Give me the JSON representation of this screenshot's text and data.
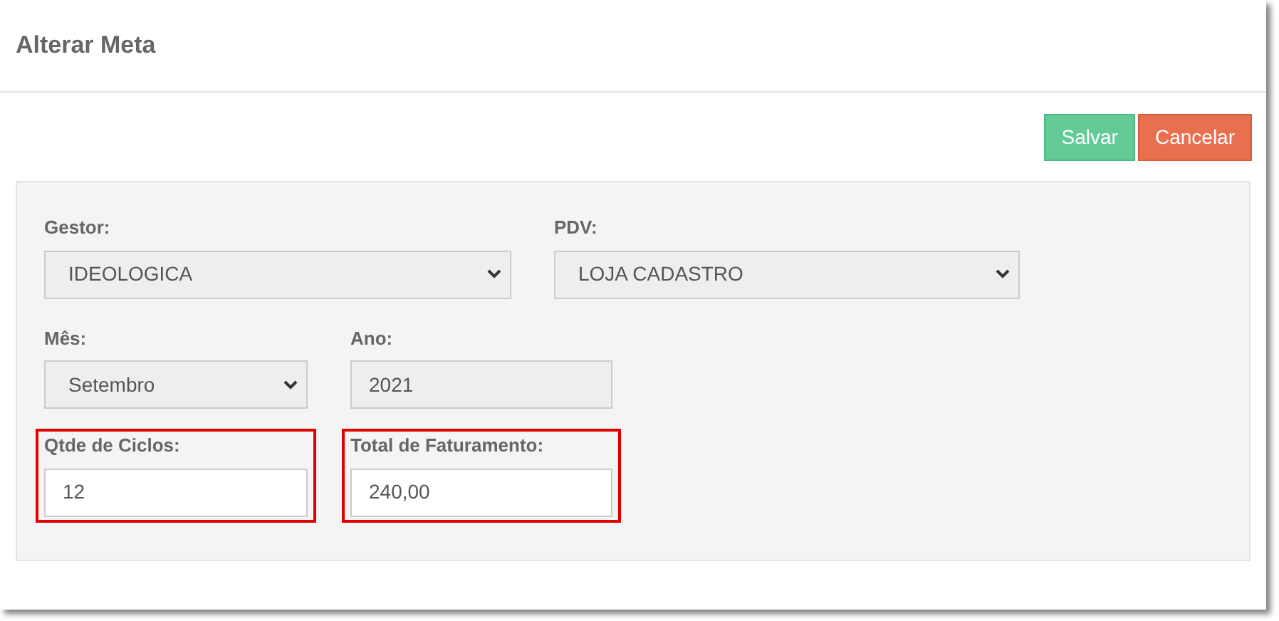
{
  "window": {
    "title": "Alterar Meta"
  },
  "buttons": [
    {
      "label": "Salvar",
      "kind": "save"
    },
    {
      "label": "Cancelar",
      "kind": "cancel"
    }
  ],
  "rows": [
    {
      "fields": [
        {
          "label": "Gestor:",
          "kind": "select",
          "value": "IDEOLOGICA",
          "highlighted": false
        },
        {
          "label": "PDV:",
          "kind": "select",
          "value": "LOJA CADASTRO",
          "highlighted": false
        }
      ]
    },
    {
      "fields": [
        {
          "label": "Mês:",
          "kind": "select",
          "value": "Setembro",
          "highlighted": false
        },
        {
          "label": "Ano:",
          "kind": "readonly",
          "value": "2021",
          "highlighted": false
        }
      ]
    },
    {
      "fields": [
        {
          "label": "Qtde de Ciclos:",
          "kind": "input",
          "value": "12",
          "highlighted": true
        },
        {
          "label": "Total de Faturamento:",
          "kind": "input",
          "value": "240,00",
          "highlighted": true
        }
      ]
    }
  ]
}
